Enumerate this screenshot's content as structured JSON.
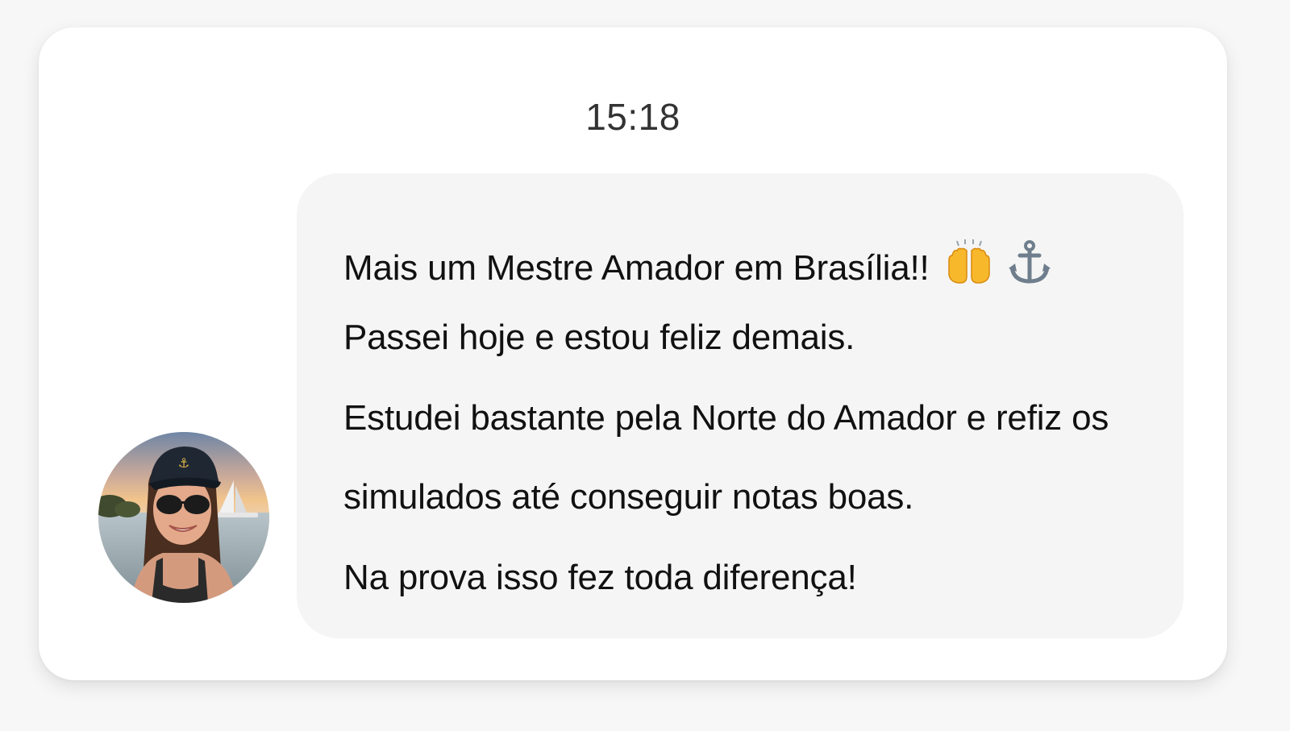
{
  "chat": {
    "timestamp": "15:18",
    "message": {
      "line1": "Mais um Mestre Amador em Brasília!!",
      "line2": "Passei hoje e estou feliz demais.",
      "line3": "Estudei bastante pela Norte do Amador e refiz os",
      "line4": "simulados até conseguir notas boas.",
      "line5": "Na prova isso fez toda diferença!",
      "emojis": [
        "raising-hands-icon",
        "anchor-icon"
      ]
    },
    "avatar": {
      "icon": "user-avatar-photo"
    }
  }
}
